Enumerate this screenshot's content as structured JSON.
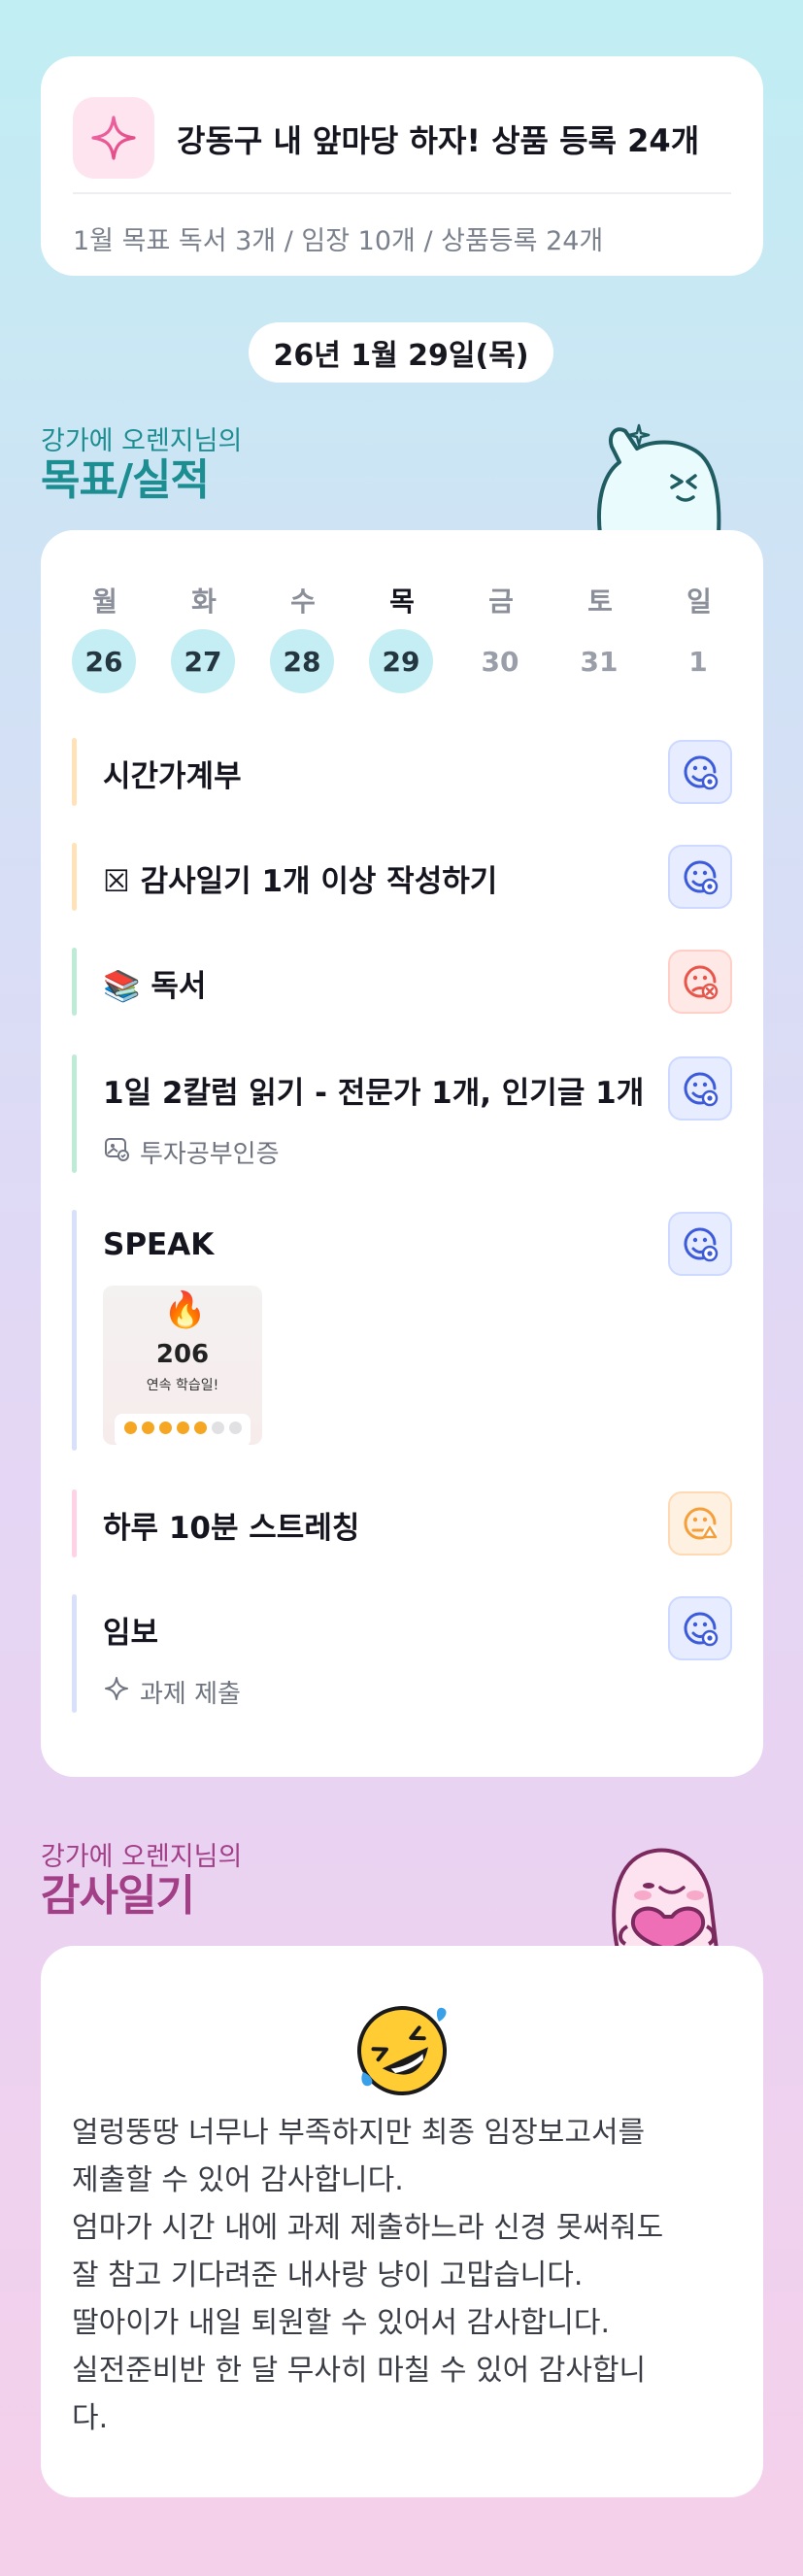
{
  "goal_card": {
    "title": "강동구 내 앞마당 하자! 상품 등록 24개",
    "subtitle": "1월 목표  독서 3개 / 임장 10개 / 상품등록 24개",
    "icon": "sparkle-icon"
  },
  "date": "26년 1월 29일(목)",
  "goals_section": {
    "subtitle": "강가에 오렌지님의",
    "title": "목표/실적"
  },
  "week": [
    {
      "dow": "월",
      "num": "26",
      "state": "done"
    },
    {
      "dow": "화",
      "num": "27",
      "state": "done"
    },
    {
      "dow": "수",
      "num": "28",
      "state": "done"
    },
    {
      "dow": "목",
      "num": "29",
      "state": "today"
    },
    {
      "dow": "금",
      "num": "30",
      "state": "future"
    },
    {
      "dow": "토",
      "num": "31",
      "state": "future"
    },
    {
      "dow": "일",
      "num": "1",
      "state": "future"
    }
  ],
  "tasks": [
    {
      "label": "시간가계부",
      "status": "ok",
      "bar_color": "#ffe2b8"
    },
    {
      "label": "☒ 감사일기 1개 이상 작성하기",
      "status": "ok",
      "bar_color": "#ffe2b8"
    },
    {
      "label": "📚 독서",
      "status": "fail",
      "bar_color": "#bdebd5"
    },
    {
      "label": "1일 2칼럼 읽기 - 전문가 1개, 인기글 1개",
      "status": "ok",
      "bar_color": "#bdebd5",
      "sub": "투자공부인증"
    },
    {
      "label": "SPEAK",
      "status": "ok",
      "bar_color": "#d9e0fb",
      "thumbnail": {
        "streak": "206",
        "streak_label": "연속 학습일!"
      }
    },
    {
      "label": "하루 10분 스트레칭",
      "status": "partial",
      "bar_color": "#ffd2e6"
    },
    {
      "label": "임보",
      "status": "ok",
      "bar_color": "#d9e0fb",
      "sub": "과제 제출"
    }
  ],
  "thanks_section": {
    "subtitle": "강가에 오렌지님의",
    "title": "감사일기",
    "text": "얼렁뚱땅 너무나 부족하지만 최종 임장보고서를\n제출할 수 있어 감사합니다.\n엄마가 시간 내에 과제 제출하느라 신경 못써줘도\n잘 참고 기다려준 내사랑 냥이 고맙습니다.\n딸아이가 내일 퇴원할 수 있어서 감사합니다.\n실전준비반 한 달 무사히 마칠 수 있어 감사합니\n다.",
    "emoji_icon": "rolling-laughing-emoji-icon"
  },
  "colors": {
    "goals_accent": "#1c8e92",
    "thanks_accent": "#a23f87",
    "status_ok": "#3b5bdb",
    "status_fail": "#e8554a",
    "status_partial": "#f59f3a"
  }
}
